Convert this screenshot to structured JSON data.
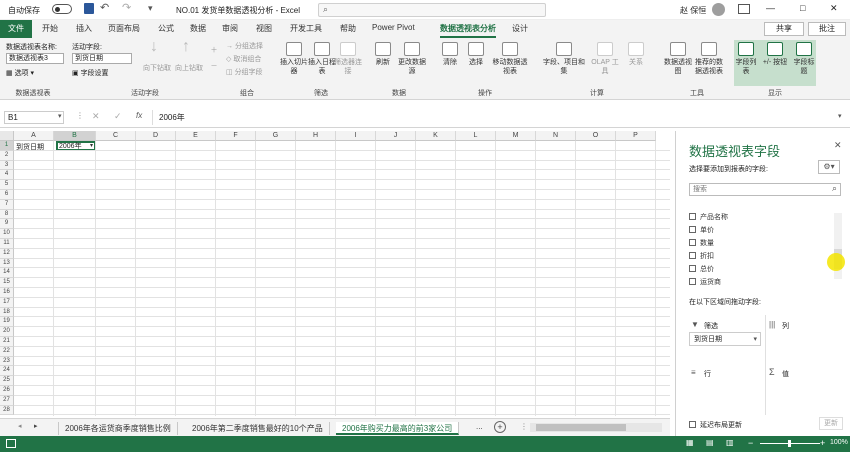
{
  "titlebar": {
    "autosave": "自动保存",
    "autosave_state": "关",
    "doc_title": "NO.01 发货单数据透视分析 - Excel",
    "user": "赵 保恒",
    "minimize": "—",
    "restore": "□",
    "close": "✕"
  },
  "menu": {
    "file": "文件",
    "tabs": [
      "开始",
      "插入",
      "页面布局",
      "公式",
      "数据",
      "审阅",
      "视图",
      "开发工具",
      "帮助",
      "Power Pivot",
      "数据透视表分析",
      "设计"
    ],
    "share": "共享",
    "comment": "批注"
  },
  "ribbon": {
    "pt_name_label": "数据透视表名称:",
    "pt_name": "数据透视表3",
    "options": "选项",
    "field_label": "活动字段:",
    "field_value": "到货日期",
    "field_settings": "字段设置",
    "drill_down": "向下钻取",
    "drill_up": "向上钻取",
    "expand": "展开字段",
    "collapse": "折叠字段",
    "group_sel": "分组选择",
    "ungroup": "取消组合",
    "group_field": "分组字段",
    "insert_slicer": "插入切片器",
    "insert_timeline": "插入日程表",
    "filter_conn": "筛选器连接",
    "refresh": "刷新",
    "change_source": "更改数据源",
    "clear": "清除",
    "select": "选择",
    "move": "移动数据透视表",
    "fields_items": "字段、项目和集",
    "olap": "OLAP 工具",
    "relations": "关系",
    "pivot_chart": "数据透视图",
    "recommended": "推荐的数据透视表",
    "field_list": "字段列表",
    "buttons": "+/- 按钮",
    "headers": "字段标题",
    "groups": [
      "数据透视表",
      "活动字段",
      "组合",
      "筛选",
      "数据",
      "操作",
      "计算",
      "工具",
      "显示"
    ]
  },
  "formula": {
    "cell_ref": "B1",
    "fx": "fx",
    "value": "2006年"
  },
  "sheet": {
    "columns": [
      "A",
      "B",
      "C",
      "D",
      "E",
      "F",
      "G",
      "H",
      "I",
      "J",
      "K",
      "L",
      "M",
      "N",
      "O",
      "P"
    ],
    "a1": "到货日期",
    "b1": "2006年",
    "row_count": 28
  },
  "panel": {
    "title": "数据透视表字段",
    "subtitle": "选择要添加到报表的字段:",
    "search": "搜索",
    "fields": [
      "产品名称",
      "单价",
      "数量",
      "折扣",
      "总价",
      "运货商"
    ],
    "drag_label": "在以下区域间拖动字段:",
    "filter_area": "筛选",
    "columns_area": "列",
    "rows_area": "行",
    "values_area": "值",
    "filter_item": "到货日期",
    "defer": "延迟布局更新",
    "update": "更新"
  },
  "sheettabs": [
    "2006年各运货商季度销售比例",
    "2006年第二季度销售最好的10个产品",
    "2006年购买力最高的前3家公司"
  ],
  "active_tab": 2,
  "more_tabs": "...",
  "status": {
    "zoom": "100%"
  },
  "colors": {
    "accent": "#217346",
    "menu_active": "#217346"
  }
}
